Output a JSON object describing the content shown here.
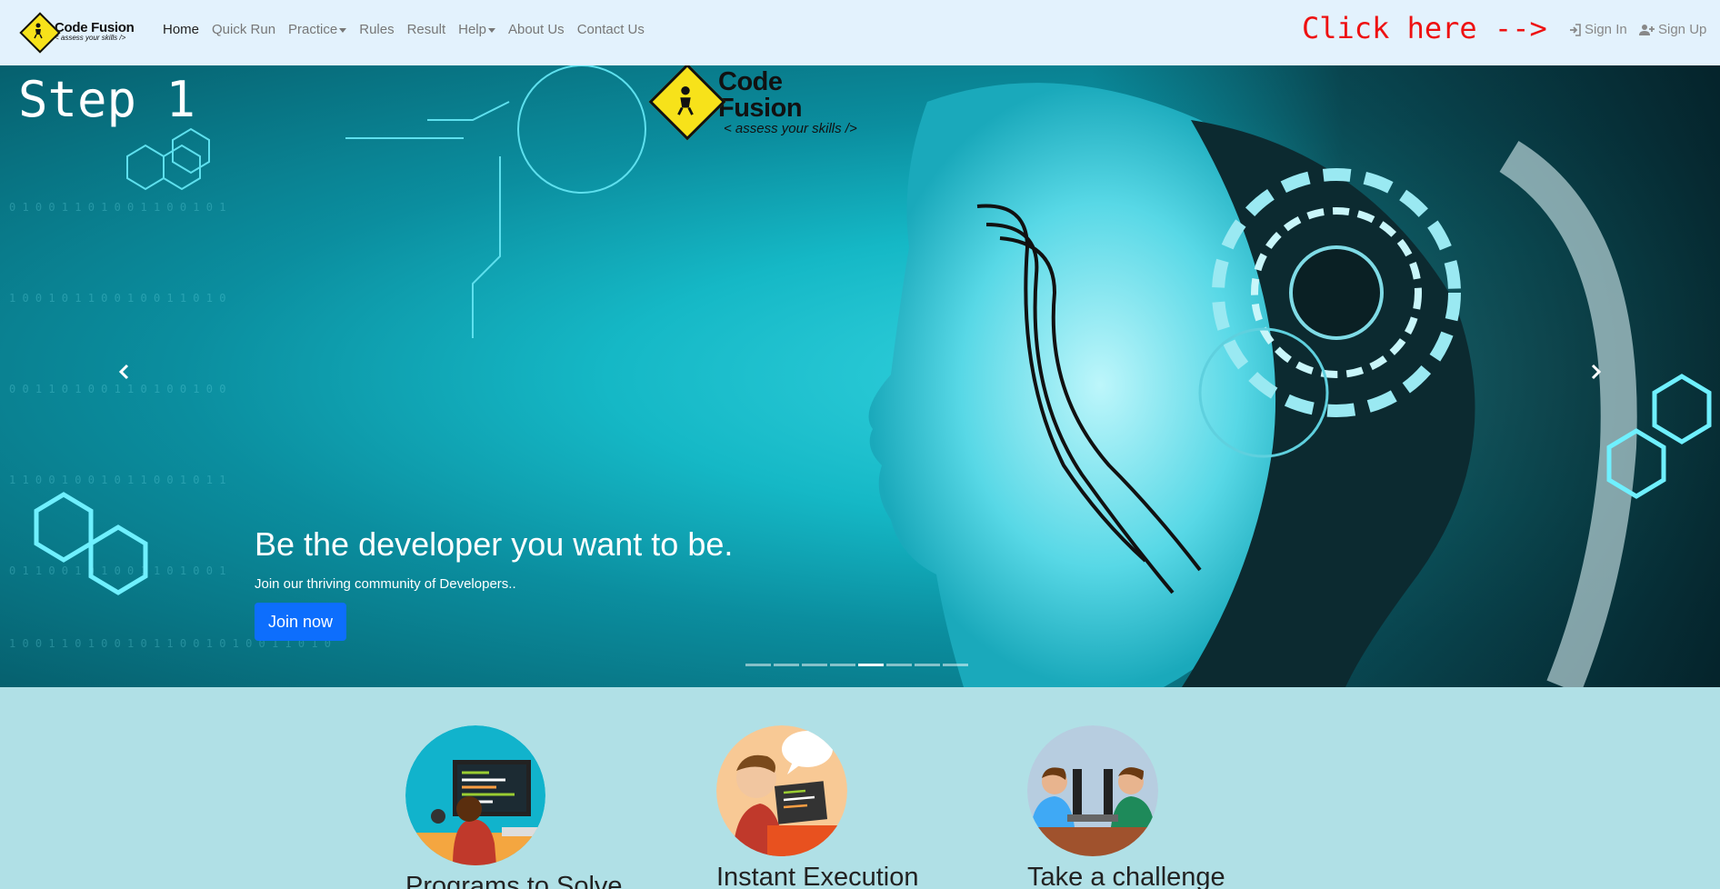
{
  "brand": {
    "name": "Code Fusion",
    "tagline": "< assess your skills />"
  },
  "nav": {
    "items": [
      {
        "label": "Home"
      },
      {
        "label": "Quick Run"
      },
      {
        "label": "Practice"
      },
      {
        "label": "Rules"
      },
      {
        "label": "Result"
      },
      {
        "label": "Help"
      },
      {
        "label": "About Us"
      },
      {
        "label": "Contact Us"
      }
    ],
    "click_hint": "Click here -->",
    "sign_in": "Sign In",
    "sign_up": "Sign Up"
  },
  "hero": {
    "step": "Step 1",
    "logo_name": "Code Fusion",
    "logo_tagline": "< assess your skills />",
    "headline": "Be the developer you want to be.",
    "subtext": "Join our thriving community of Developers..",
    "button": "Join now",
    "slides_total": 8,
    "active_slide": 5
  },
  "features": [
    {
      "title": "Programs to Solve"
    },
    {
      "title": "Instant Execution"
    },
    {
      "title": "Take a challenge"
    }
  ],
  "colors": {
    "navbar_bg": "#e3f2fd",
    "accent_red": "#ee1111",
    "button_blue": "#0d6efd",
    "section_bg": "#b0e0e6"
  }
}
